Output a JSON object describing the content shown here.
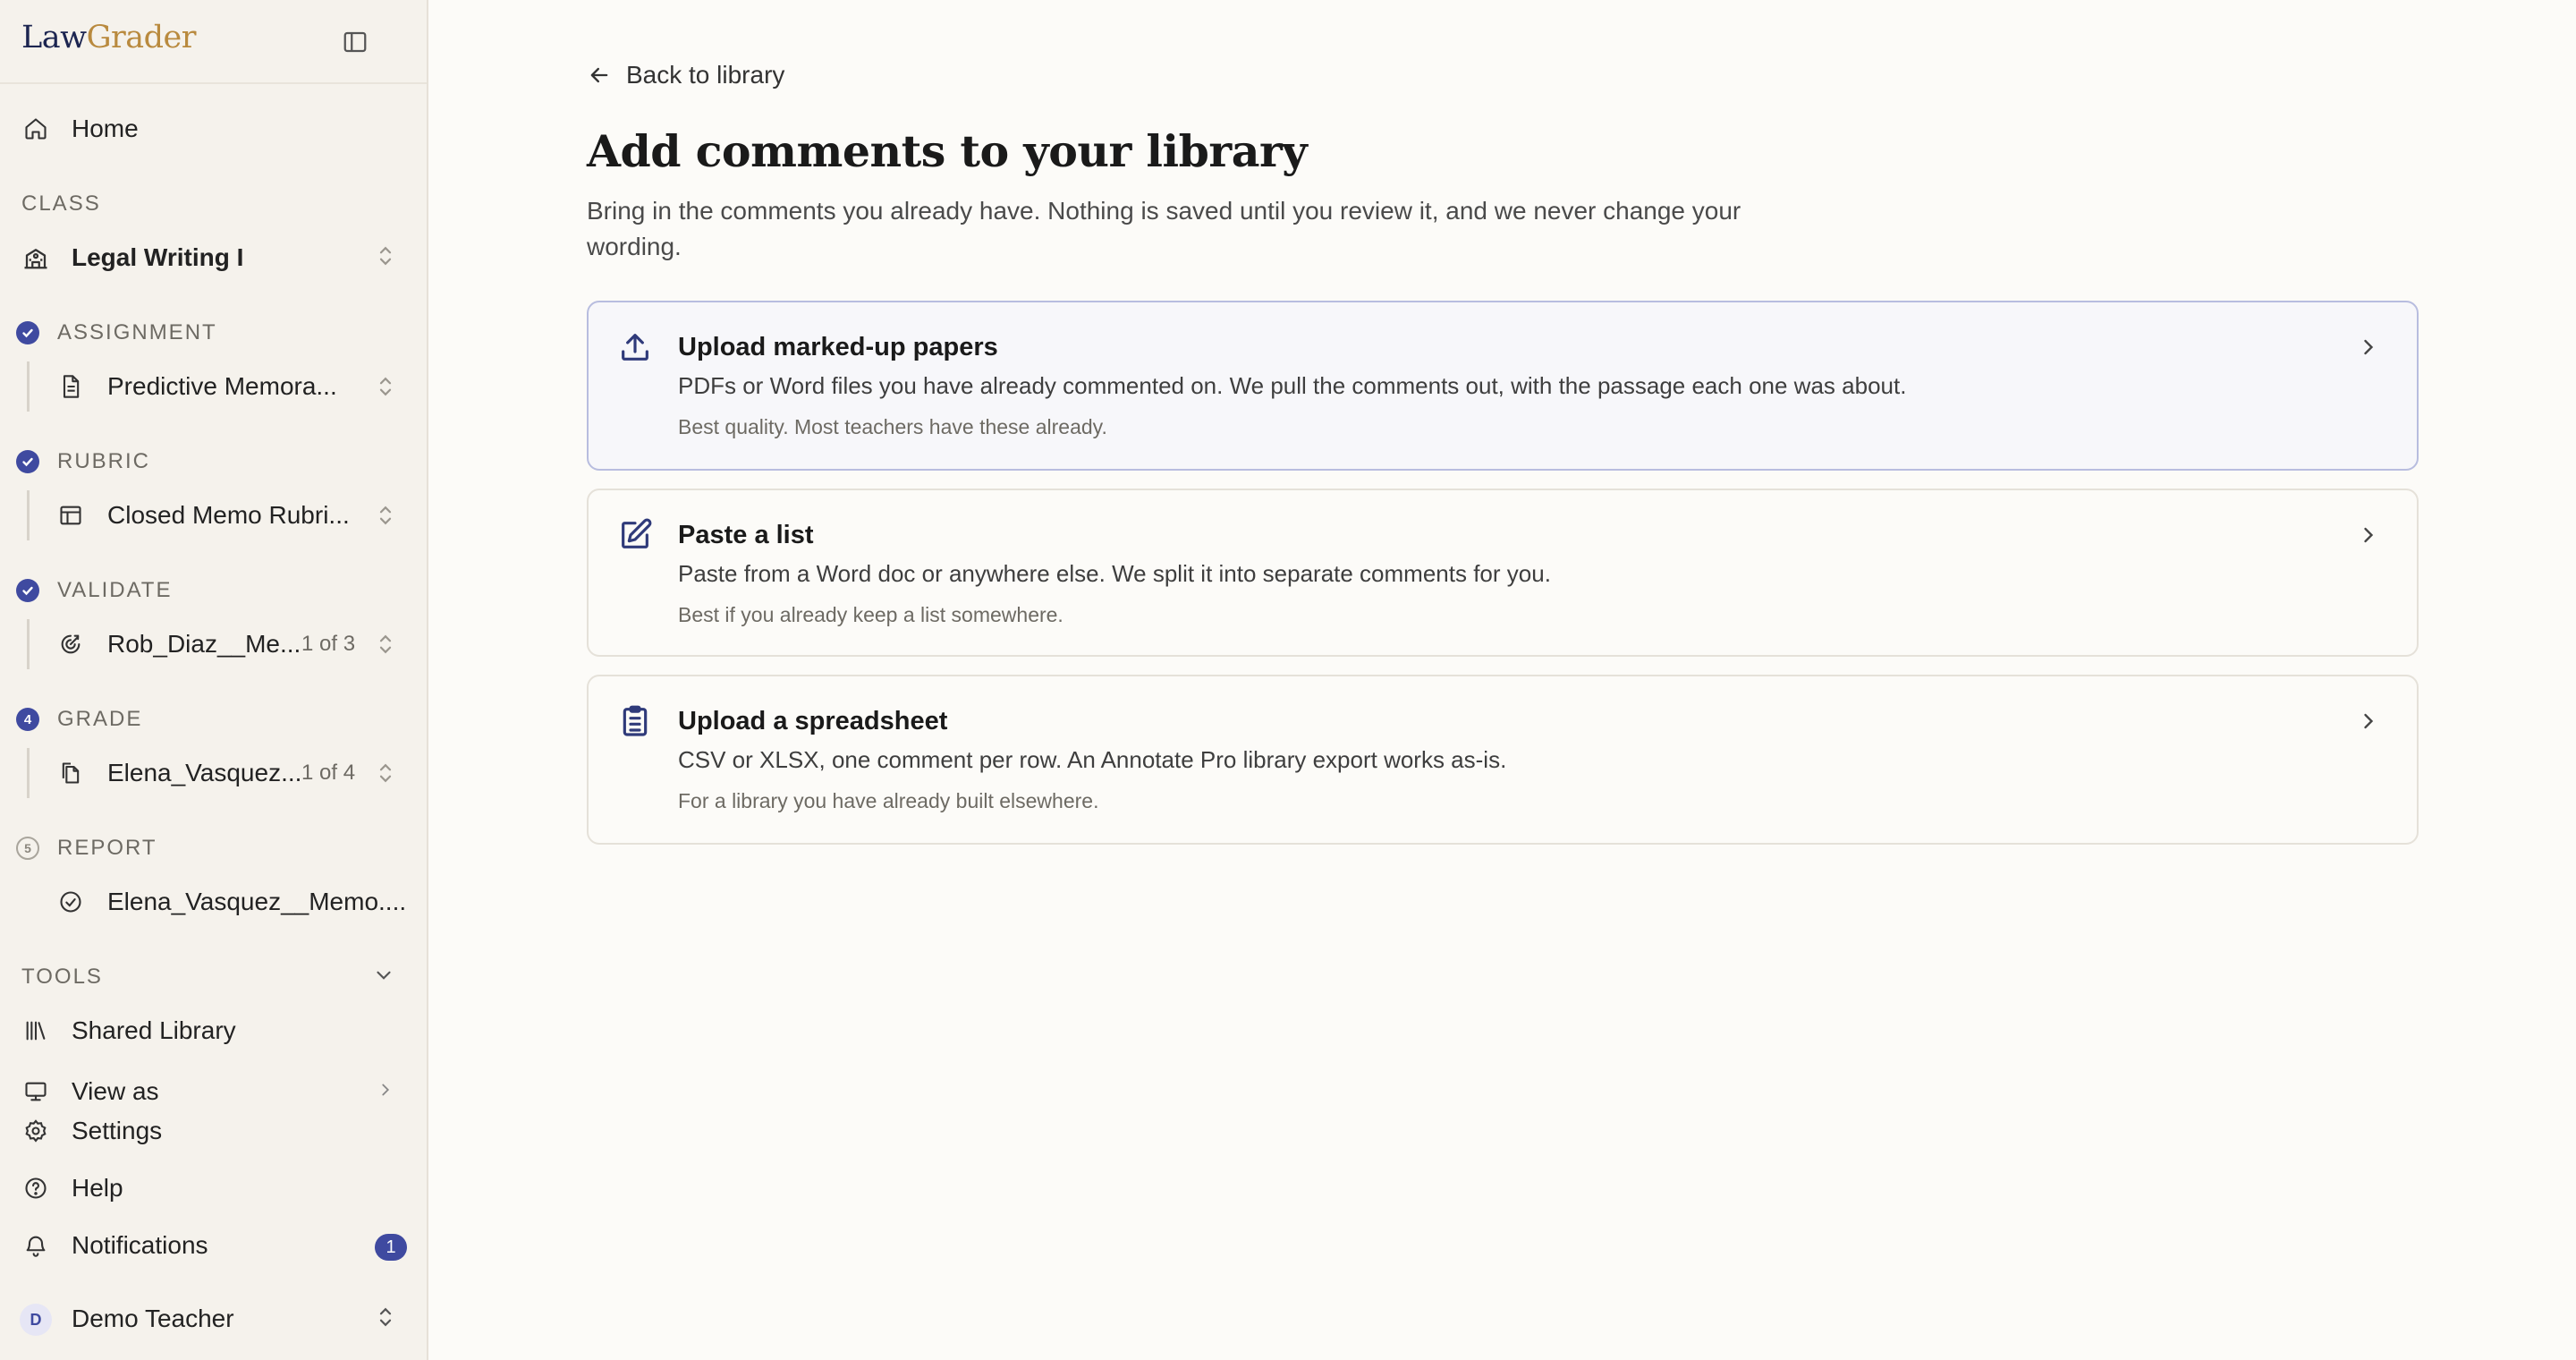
{
  "app": {
    "logo_part1": "Law",
    "logo_part2": "Grader"
  },
  "sidebar": {
    "home": "Home",
    "class_label": "CLASS",
    "class_name": "Legal Writing I",
    "steps": [
      {
        "label": "ASSIGNMENT",
        "marker": "",
        "item": "Predictive Memora...",
        "count": ""
      },
      {
        "label": "RUBRIC",
        "marker": "",
        "item": "Closed Memo Rubri...",
        "count": ""
      },
      {
        "label": "VALIDATE",
        "marker": "",
        "item": "Rob_Diaz__Me...",
        "count": "1 of 3"
      },
      {
        "label": "GRADE",
        "marker": "4",
        "item": "Elena_Vasquez...",
        "count": "1 of 4"
      },
      {
        "label": "REPORT",
        "marker": "5",
        "item": "Elena_Vasquez__Memo....",
        "count": ""
      }
    ],
    "tools_label": "TOOLS",
    "tools": {
      "shared_library": "Shared Library",
      "view_as": "View as",
      "settings": "Settings",
      "help": "Help",
      "notifications": "Notifications",
      "notifications_count": "1"
    },
    "user": {
      "initial": "D",
      "name": "Demo Teacher"
    }
  },
  "main": {
    "back": "Back to library",
    "title": "Add comments to your library",
    "subtitle": "Bring in the comments you already have. Nothing is saved until you review it, and we never change your wording.",
    "options": [
      {
        "icon": "upload-icon",
        "title": "Upload marked-up papers",
        "desc": "PDFs or Word files you have already commented on. We pull the comments out, with the passage each one was about.",
        "note": "Best quality. Most teachers have these already."
      },
      {
        "icon": "edit-icon",
        "title": "Paste a list",
        "desc": "Paste from a Word doc or anywhere else. We split it into separate comments for you.",
        "note": "Best if you already keep a list somewhere."
      },
      {
        "icon": "clipboard-list-icon",
        "title": "Upload a spreadsheet",
        "desc": "CSV or XLSX, one comment per row. An Annotate Pro library export works as-is.",
        "note": "For a library you have already built elsewhere."
      }
    ]
  },
  "colors": {
    "accent": "#3f4aa0",
    "brand_gold": "#b98a3e",
    "brand_navy": "#1c2550",
    "sidebar_bg": "#f5f2ec",
    "page_bg": "#fcfbf8"
  }
}
